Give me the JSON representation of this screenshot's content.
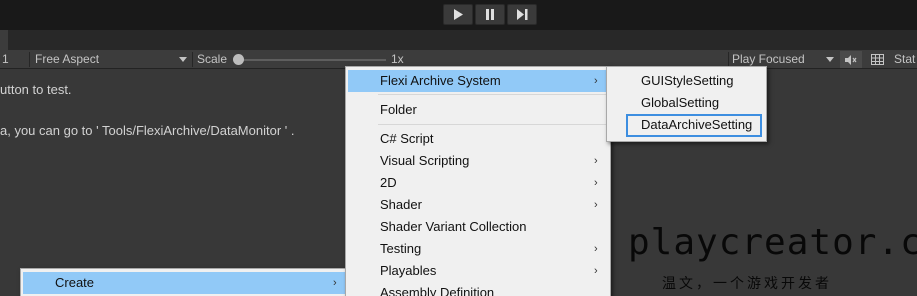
{
  "playbar": {
    "play_icon": "play-icon",
    "pause_icon": "pause-icon",
    "step_icon": "step-icon"
  },
  "toolbar": {
    "display_value": "1",
    "aspect_value": "Free Aspect",
    "scale_label": "Scale",
    "scale_value": "1x",
    "scale_fraction": 0.0,
    "play_mode_value": "Play Focused",
    "mute_icon": "mute-audio-icon",
    "gizmos_icon": "grid-icon",
    "stats_label": "Stat"
  },
  "game_view": {
    "line1": "utton to test.",
    "line2": "a, you can go to ' Tools/FlexiArchive/DataMonitor ' ."
  },
  "context_menu": {
    "create_label": "Create"
  },
  "create_menu": {
    "items": [
      {
        "label": "Flexi Archive System",
        "submenu": true
      },
      {
        "label": "Folder",
        "submenu": false
      },
      {
        "label": "C# Script",
        "submenu": false
      },
      {
        "label": "Visual Scripting",
        "submenu": true
      },
      {
        "label": "2D",
        "submenu": true
      },
      {
        "label": "Shader",
        "submenu": true
      },
      {
        "label": "Shader Variant Collection",
        "submenu": false
      },
      {
        "label": "Testing",
        "submenu": true
      },
      {
        "label": "Playables",
        "submenu": true
      },
      {
        "label": "Assembly Definition",
        "submenu": false
      }
    ]
  },
  "flexi_menu": {
    "items": [
      {
        "label": "GUIStyleSetting"
      },
      {
        "label": "GlobalSetting"
      },
      {
        "label": "DataArchiveSetting"
      }
    ]
  },
  "watermark": {
    "site": "playcreator.cn",
    "tagline": "温文，一个游戏开发者"
  },
  "colors": {
    "highlight": "#91c9f7",
    "frame": "#3d8ee0"
  }
}
